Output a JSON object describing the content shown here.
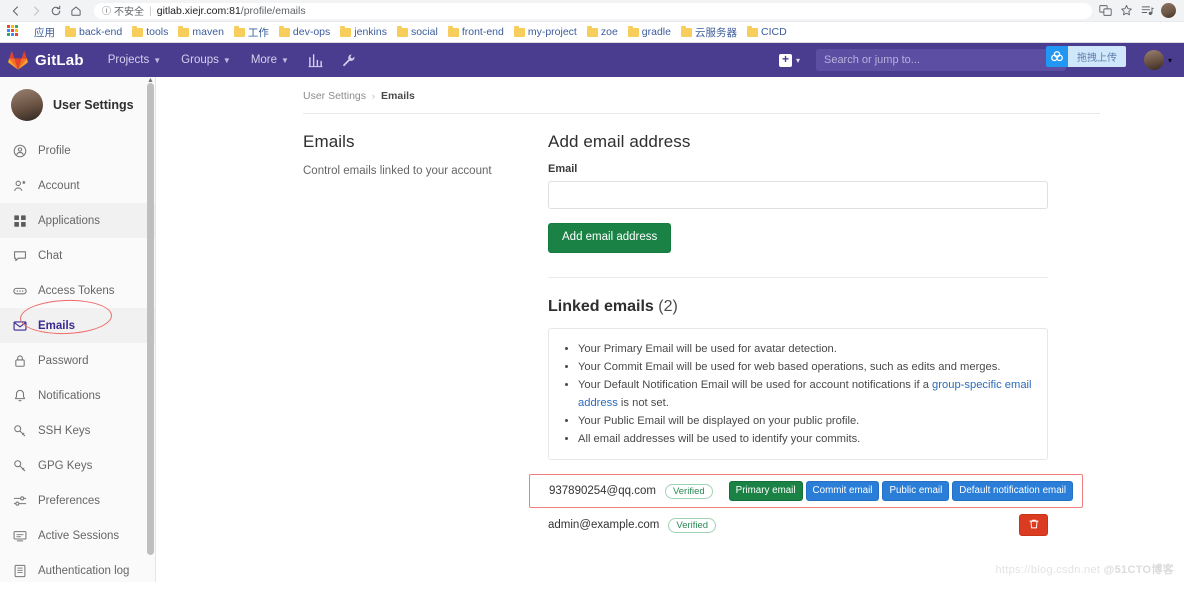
{
  "browser": {
    "back_icon": "back-arrow-icon",
    "forward_icon": "forward-arrow-icon",
    "reload_icon": "reload-icon",
    "home_icon": "home-icon",
    "security_label": "不安全",
    "url_host": "gitlab.xiejr.com:81",
    "url_path": "/profile/emails",
    "translate_icon": "translate-icon",
    "bookmark_star_icon": "star-icon",
    "extension_icon": "playlist-icon",
    "profile_icon": "browser-profile-avatar",
    "apps_label": "应用",
    "bookmarks": [
      {
        "label": "back-end"
      },
      {
        "label": "tools"
      },
      {
        "label": "maven"
      },
      {
        "label": "工作"
      },
      {
        "label": "dev-ops"
      },
      {
        "label": "jenkins"
      },
      {
        "label": "social"
      },
      {
        "label": "front-end"
      },
      {
        "label": "my-project"
      },
      {
        "label": "zoe"
      },
      {
        "label": "gradle"
      },
      {
        "label": "云服务器"
      },
      {
        "label": "CICD"
      }
    ]
  },
  "navbar": {
    "brand": "GitLab",
    "menu": [
      {
        "label": "Projects",
        "caret": true
      },
      {
        "label": "Groups",
        "caret": true
      },
      {
        "label": "More",
        "caret": true
      }
    ],
    "analytics_icon": "chart-icon",
    "admin_icon": "wrench-icon",
    "plus_icon": "plus-square-icon",
    "plus_caret": "▾",
    "search_placeholder": "Search or jump to...",
    "search_value": "",
    "search_icon": "search-icon",
    "issues_icon": "issues-icon",
    "merge_requests_icon": "merge-request-icon",
    "avatar_icon": "user-avatar",
    "avatar_caret": "▾",
    "upload_widget": {
      "icon": "cloud-upload-icon",
      "label": "拖拽上传"
    }
  },
  "sidebar": {
    "title": "User Settings",
    "avatar_icon": "user-avatar-large",
    "items": [
      {
        "label": "Profile",
        "icon": "profile-icon"
      },
      {
        "label": "Account",
        "icon": "account-icon"
      },
      {
        "label": "Applications",
        "icon": "applications-icon"
      },
      {
        "label": "Chat",
        "icon": "chat-icon"
      },
      {
        "label": "Access Tokens",
        "icon": "access-tokens-icon"
      },
      {
        "label": "Emails",
        "icon": "email-icon"
      },
      {
        "label": "Password",
        "icon": "lock-icon"
      },
      {
        "label": "Notifications",
        "icon": "bell-icon"
      },
      {
        "label": "SSH Keys",
        "icon": "key-icon"
      },
      {
        "label": "GPG Keys",
        "icon": "key-icon"
      },
      {
        "label": "Preferences",
        "icon": "sliders-icon"
      },
      {
        "label": "Active Sessions",
        "icon": "monitor-icon"
      },
      {
        "label": "Authentication log",
        "icon": "log-icon"
      }
    ]
  },
  "breadcrumb": {
    "root": "User Settings",
    "separator": "›",
    "current": "Emails"
  },
  "main": {
    "left": {
      "heading": "Emails",
      "description": "Control emails linked to your account"
    },
    "add_email": {
      "heading": "Add email address",
      "field_label": "Email",
      "field_value": "",
      "field_placeholder": "",
      "submit_label": "Add email address"
    },
    "linked": {
      "heading_main": "Linked emails",
      "heading_count": "(2)",
      "notes": [
        {
          "text": "Your Primary Email will be used for avatar detection."
        },
        {
          "text": "Your Commit Email will be used for web based operations, such as edits and merges."
        },
        {
          "text_before": "Your Default Notification Email will be used for account notifications if a ",
          "link": "group-specific email address",
          "text_after": " is not set."
        },
        {
          "text": "Your Public Email will be displayed on your public profile."
        },
        {
          "text": "All email addresses will be used to identify your commits."
        }
      ],
      "rows": [
        {
          "address": "937890254@qq.com",
          "verified_label": "Verified",
          "highlighted": true,
          "badges": [
            {
              "label": "Primary email",
              "style": "primary"
            },
            {
              "label": "Commit email",
              "style": "blue"
            },
            {
              "label": "Public email",
              "style": "blue"
            },
            {
              "label": "Default notification email",
              "style": "blue"
            }
          ],
          "has_delete": false
        },
        {
          "address": "admin@example.com",
          "verified_label": "Verified",
          "highlighted": false,
          "badges": [],
          "has_delete": true,
          "delete_icon": "trash-icon"
        }
      ]
    }
  },
  "watermark": {
    "text1": "https://blog.csdn.net",
    "text2": "@51CTO博客"
  },
  "colors": {
    "gitlab_purple": "#4a3d8f",
    "green_accent": "#1a8245",
    "blue_badge": "#2b7ed8",
    "red_delete": "#db3b21",
    "annotation_red": "#f17e7e",
    "link_blue": "#2b6cb8"
  }
}
